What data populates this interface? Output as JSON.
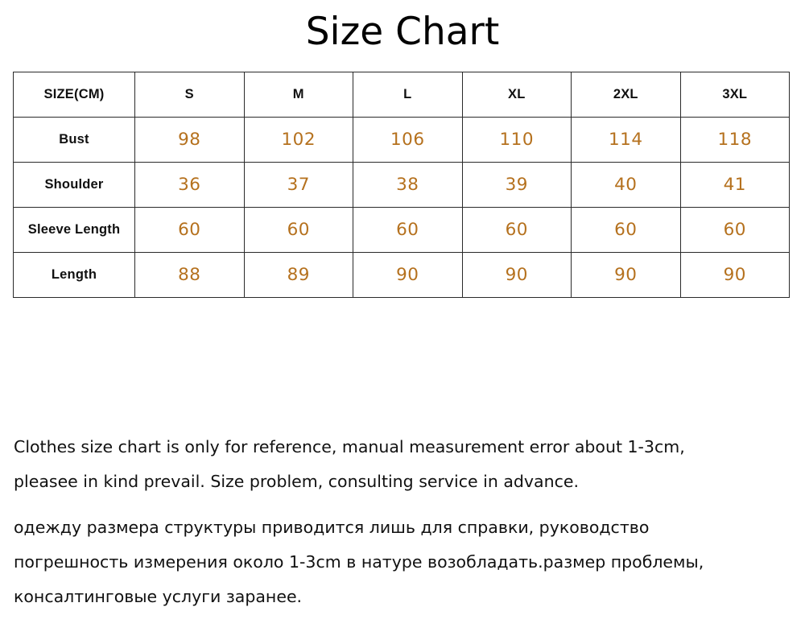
{
  "page": {
    "title": "Size Chart",
    "accent_color": "#b5711e",
    "text_color": "#101010",
    "border_color": "#2a2a2a",
    "background": "#ffffff"
  },
  "table": {
    "columns": [
      "SIZE(CM)",
      "S",
      "M",
      "L",
      "XL",
      "2XL",
      "3XL"
    ],
    "rows": [
      {
        "label": "Bust",
        "values": [
          "98",
          "102",
          "106",
          "110",
          "114",
          "118"
        ]
      },
      {
        "label": "Shoulder",
        "values": [
          "36",
          "37",
          "38",
          "39",
          "40",
          "41"
        ]
      },
      {
        "label": "Sleeve Length",
        "values": [
          "60",
          "60",
          "60",
          "60",
          "60",
          "60"
        ]
      },
      {
        "label": "Length",
        "values": [
          "88",
          "89",
          "90",
          "90",
          "90",
          "90"
        ]
      }
    ]
  },
  "notes": {
    "english": [
      "Clothes size chart is only for reference, manual measurement error about 1-3cm,",
      "pleasee in kind prevail. Size problem, consulting service in advance."
    ],
    "russian": [
      "одежду размера структуры приводится лишь для справки, руководство",
      "погрешность измерения около 1-3cm в натуре возобладать.размер проблемы,",
      "консалтинговые услуги заранее."
    ]
  }
}
